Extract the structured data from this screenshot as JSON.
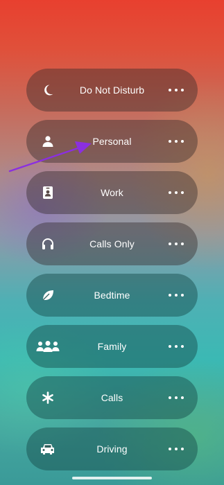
{
  "focus_modes": [
    {
      "label": "Do Not Disturb",
      "icon": "moon-icon"
    },
    {
      "label": "Personal",
      "icon": "person-icon"
    },
    {
      "label": "Work",
      "icon": "id-badge-icon"
    },
    {
      "label": "Calls Only",
      "icon": "headphones-icon"
    },
    {
      "label": "Bedtime",
      "icon": "leaf-icon"
    },
    {
      "label": "Family",
      "icon": "people-icon"
    },
    {
      "label": "Calls",
      "icon": "asterisk-icon"
    },
    {
      "label": "Driving",
      "icon": "car-icon"
    }
  ],
  "colors": {
    "annotation_arrow": "#8b2fe0",
    "text": "#ffffff"
  }
}
